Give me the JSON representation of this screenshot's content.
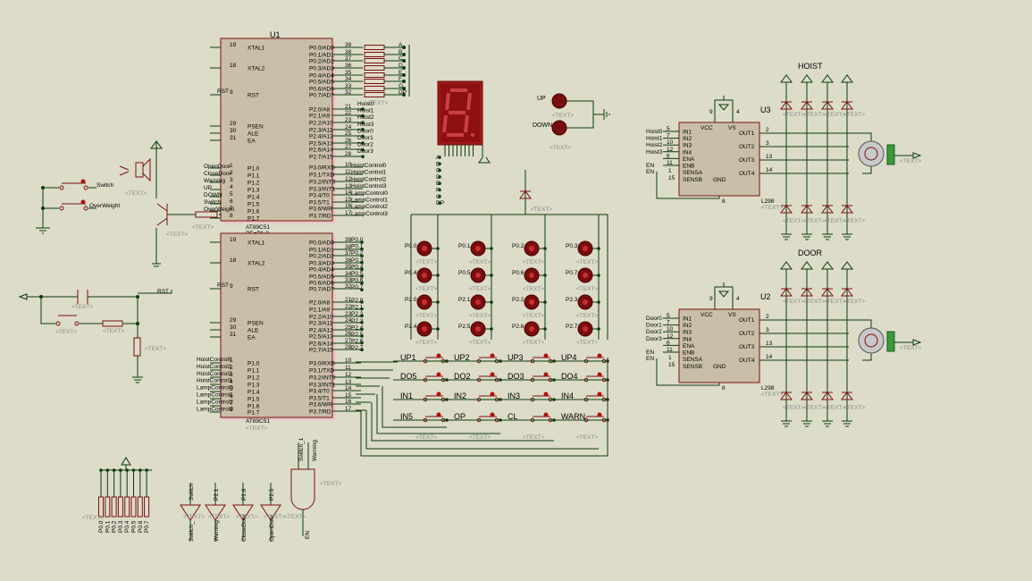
{
  "u1": {
    "ref": "U1",
    "part": "AT89C51",
    "left_pins": [
      {
        "n": "19",
        "name": "XTAL1"
      },
      {
        "n": "18",
        "name": "XTAL2"
      },
      {
        "n": "9",
        "name": "RST"
      },
      {
        "n": "29",
        "name": "PSEN"
      },
      {
        "n": "30",
        "name": "ALE"
      },
      {
        "n": "31",
        "name": "EA"
      },
      {
        "n": "1",
        "name": "P1.0"
      },
      {
        "n": "2",
        "name": "P1.1"
      },
      {
        "n": "3",
        "name": "P1.2"
      },
      {
        "n": "4",
        "name": "P1.3"
      },
      {
        "n": "5",
        "name": "P1.4"
      },
      {
        "n": "6",
        "name": "P1.5"
      },
      {
        "n": "7",
        "name": "P1.6"
      },
      {
        "n": "8",
        "name": "P1.7"
      }
    ],
    "right_pins": [
      {
        "n": "39",
        "name": "P0.0/AD0"
      },
      {
        "n": "38",
        "name": "P0.1/AD1"
      },
      {
        "n": "37",
        "name": "P0.2/AD2"
      },
      {
        "n": "36",
        "name": "P0.3/AD3"
      },
      {
        "n": "35",
        "name": "P0.4/AD4"
      },
      {
        "n": "34",
        "name": "P0.5/AD5"
      },
      {
        "n": "33",
        "name": "P0.6/AD6"
      },
      {
        "n": "32",
        "name": "P0.7/AD7"
      },
      {
        "n": "21",
        "name": "P2.0/A8"
      },
      {
        "n": "22",
        "name": "P2.1/A9"
      },
      {
        "n": "23",
        "name": "P2.2/A10"
      },
      {
        "n": "24",
        "name": "P2.3/A11"
      },
      {
        "n": "25",
        "name": "P2.4/A12"
      },
      {
        "n": "26",
        "name": "P2.5/A13"
      },
      {
        "n": "27",
        "name": "P2.6/A14"
      },
      {
        "n": "28",
        "name": "P2.7/A15"
      },
      {
        "n": "10",
        "name": "P3.0/RXD"
      },
      {
        "n": "11",
        "name": "P3.1/TXD"
      },
      {
        "n": "12",
        "name": "P3.2/INT0"
      },
      {
        "n": "13",
        "name": "P3.3/INT1"
      },
      {
        "n": "14",
        "name": "P3.4/T0"
      },
      {
        "n": "15",
        "name": "P3.5/T1"
      },
      {
        "n": "16",
        "name": "P3.6/WR"
      },
      {
        "n": "17",
        "name": "P3.7/RD"
      }
    ],
    "p1_nets": [
      "OpenDoor",
      "CloseDoor",
      "Warning",
      "UP",
      "DOWN",
      "Switch",
      "OverWeight"
    ],
    "p2_nets": [
      "Hoist0",
      "Hoist1",
      "Hoist2",
      "Hoist3",
      "Door0",
      "Door1",
      "Door2",
      "Door3"
    ],
    "p3_nets": [
      "HoistControl0",
      "HoistControl1",
      "HoistControl2",
      "HoistControl3",
      "LampControl0",
      "LampControl1",
      "LampControl2",
      "LampControl3"
    ],
    "seg_letters": [
      "A",
      "B",
      "C",
      "D",
      "E",
      "F",
      "G",
      "DP"
    ]
  },
  "u2chip": {
    "part": "AT89C51",
    "pins_note": "PE=P1.0",
    "p0_nets": [
      "P0.0",
      "P0.1",
      "P0.2",
      "P0.3",
      "P0.4",
      "P0.5",
      "P0.6",
      "P0.7"
    ],
    "p2_nets": [
      "P2.0",
      "P2.1",
      "P2.2",
      "P2.3",
      "P2.4",
      "P2.5",
      "P2.6",
      "P2.7"
    ],
    "p1_nets": [
      "HoistControl0",
      "HoistControl1",
      "HoistControl2",
      "HoistControl3",
      "LampControl0",
      "LampControl1",
      "LampControl2",
      "LampControl3"
    ]
  },
  "text_placeholder": "<TEXT>",
  "labels": {
    "switch": "Switch",
    "overweight": "OverWeight",
    "rst": "RST",
    "up": "UP",
    "down": "DOWN",
    "hoist": "HOIST",
    "door": "DOOR",
    "u3": "U3",
    "u2": "U2",
    "l298": "L298",
    "en": "EN",
    "switch1": "Switch_1",
    "warning": "Warning"
  },
  "driver": {
    "left_pins": [
      {
        "n": "5",
        "name": "IN1"
      },
      {
        "n": "7",
        "name": "IN2"
      },
      {
        "n": "10",
        "name": "IN3"
      },
      {
        "n": "12",
        "name": "IN4"
      },
      {
        "n": "6",
        "name": "ENA"
      },
      {
        "n": "11",
        "name": "ENB"
      }
    ],
    "vcc": "VCC",
    "vs": "VS",
    "gnd": "GND",
    "outs": [
      {
        "n": "2",
        "name": "OUT1"
      },
      {
        "n": "3",
        "name": "OUT2"
      },
      {
        "n": "13",
        "name": "OUT3"
      },
      {
        "n": "14",
        "name": "OUT4"
      }
    ],
    "sensa": {
      "n": "1",
      "name": "SENSA"
    },
    "sensb": {
      "n": "15",
      "name": "SENSB"
    },
    "pin9": "9",
    "pin4": "4",
    "pin8": "8",
    "hoist_inputs": [
      "Hoist0",
      "Hoist1",
      "Hoist2",
      "Hoist3"
    ],
    "door_inputs": [
      "Door0",
      "Door1",
      "Door2",
      "Door3"
    ]
  },
  "leds": {
    "rows": [
      [
        "P0.0",
        "P0.1",
        "P0.2",
        "P0.3"
      ],
      [
        "P0.4",
        "P0.5",
        "P0.6",
        "P0.7"
      ],
      [
        "P2.0",
        "P2.1",
        "P2.2",
        "P2.3"
      ],
      [
        "P2.4",
        "P2.5",
        "P2.6",
        "P2.7"
      ]
    ]
  },
  "keypad": {
    "rows": [
      [
        "UP1",
        "UP2",
        "UP3",
        "UP4"
      ],
      [
        "DO5",
        "DO2",
        "DO3",
        "DO4"
      ],
      [
        "IN1",
        "IN2",
        "IN3",
        "IN4"
      ],
      [
        "IN5",
        "OP",
        "CL",
        "WARN"
      ]
    ]
  },
  "resistor_pack_pins": [
    "P0.0",
    "P0.1",
    "P0.2",
    "P0.3",
    "P0.4",
    "P0.5",
    "P0.6",
    "P0.7"
  ],
  "buffers": [
    {
      "top": "Switch",
      "bottom": "Switch_"
    },
    {
      "top": "P2.1",
      "bottom": "Warning"
    },
    {
      "top": "P2.6",
      "bottom": "CloseDoor"
    },
    {
      "top": "P2.5",
      "bottom": "OpenDoor"
    }
  ],
  "colors": {
    "component": "#7a1010",
    "wire": "#0b3b0b",
    "body": "#c9bfa8",
    "sheet": "#dcdcc9"
  }
}
